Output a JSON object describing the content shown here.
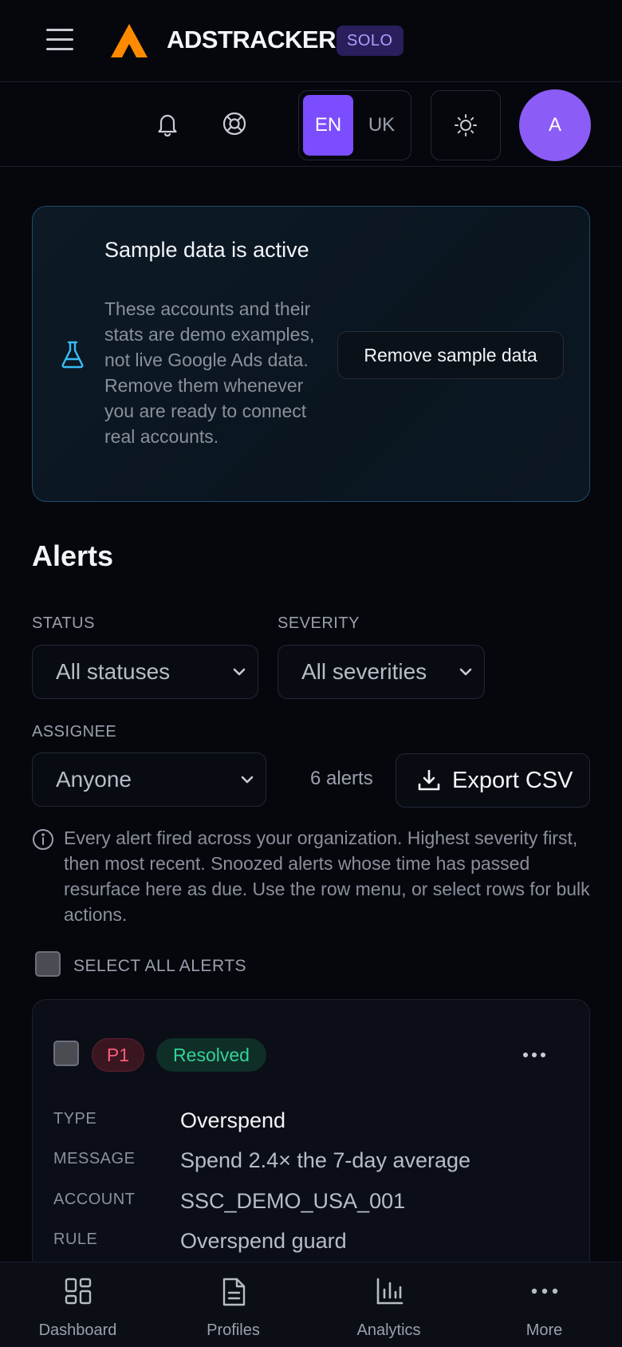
{
  "app": {
    "brand": "ADSTRACKER",
    "plan": "SOLO"
  },
  "header": {
    "languages": [
      {
        "label": "EN",
        "active": true
      },
      {
        "label": "UK",
        "active": false
      }
    ],
    "avatar_initial": "A"
  },
  "sample_banner": {
    "title": "Sample data is active",
    "description": "These accounts and their stats are demo examples, not live Google Ads data. Remove them whenever you are ready to connect real accounts.",
    "button_label": "Remove sample data"
  },
  "page": {
    "title": "Alerts"
  },
  "filters": {
    "status": {
      "label": "STATUS",
      "value": "All statuses"
    },
    "severity": {
      "label": "SEVERITY",
      "value": "All severities"
    },
    "assignee": {
      "label": "ASSIGNEE",
      "value": "Anyone"
    }
  },
  "alerts_count": "6 alerts",
  "export_label": "Export CSV",
  "info_text": "Every alert fired across your organization. Highest severity first, then most recent. Snoozed alerts whose time has passed resurface here as due. Use the row menu, or select rows for bulk actions.",
  "select_all_label": "SELECT ALL ALERTS",
  "alert": {
    "priority": "P1",
    "status": "Resolved",
    "fields": {
      "type": {
        "label": "TYPE",
        "value": "Overspend"
      },
      "message": {
        "label": "MESSAGE",
        "value": "Spend 2.4× the 7-day average"
      },
      "account": {
        "label": "ACCOUNT",
        "value": "SSC_DEMO_USA_001"
      },
      "rule": {
        "label": "RULE",
        "value": "Overspend guard"
      }
    }
  },
  "bottom_nav": [
    {
      "label": "Dashboard",
      "icon": "dashboard-icon"
    },
    {
      "label": "Profiles",
      "icon": "document-icon"
    },
    {
      "label": "Analytics",
      "icon": "bar-chart-icon"
    },
    {
      "label": "More",
      "icon": "more-horizontal-icon"
    }
  ],
  "colors": {
    "accent": "#7c4dff",
    "avatar": "#8b5cf6",
    "logo": "#ff8a00",
    "p1": "#ff5c7a",
    "resolved": "#34d399",
    "info_border": "#1f4a6b"
  }
}
